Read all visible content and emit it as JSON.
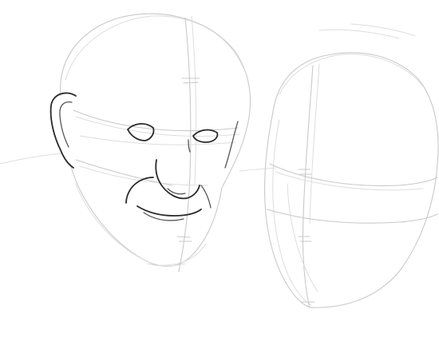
{
  "image": {
    "background_color": "#ffffff",
    "guide_color": "#c9c9c9",
    "ink_color": "#2a2a2a"
  }
}
